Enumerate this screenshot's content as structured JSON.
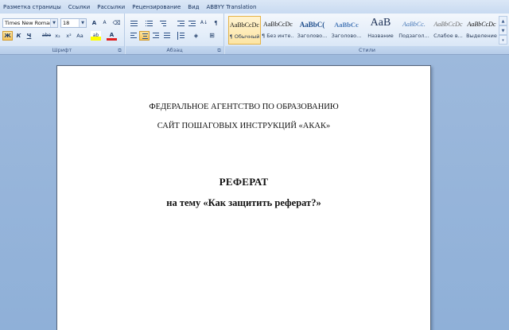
{
  "tabs": [
    "Разметка страницы",
    "Ссылки",
    "Рассылки",
    "Рецензирование",
    "Вид",
    "ABBYY Translation"
  ],
  "font": {
    "name": "Times New Roman",
    "size": "18",
    "group_label": "Шрифт",
    "buttons": {
      "grow": "A",
      "shrink": "A",
      "clear": "⌫",
      "bold": "Ж",
      "italic": "К",
      "underline": "Ч",
      "strike": "abe",
      "subscript": "x₂",
      "superscript": "x²",
      "change_case": "Aa",
      "highlight": "ab",
      "font_color": "A"
    }
  },
  "paragraph": {
    "group_label": "Абзац",
    "buttons": {
      "show_marks": "¶",
      "sort": "A↓"
    }
  },
  "styles": {
    "group_label": "Стили",
    "items": [
      {
        "sample": "AaBbCcDc",
        "name": "¶ Обычный"
      },
      {
        "sample": "AaBbCcDc",
        "name": "¶ Без инте..."
      },
      {
        "sample": "AaBbC(",
        "name": "Заголово..."
      },
      {
        "sample": "AaBbCc",
        "name": "Заголово..."
      },
      {
        "sample": "AaB",
        "name": "Название"
      },
      {
        "sample": "AaBbCc.",
        "name": "Подзагол..."
      },
      {
        "sample": "AaBbCcDc",
        "name": "Слабое в..."
      },
      {
        "sample": "AaBbCcDc",
        "name": "Выделение"
      }
    ]
  },
  "document": {
    "lines": [
      "ФЕДЕРАЛЬНОЕ АГЕНТСТВО ПО ОБРАЗОВАНИЮ",
      "САЙТ ПОШАГОВЫХ ИНСТРУКЦИЙ «АКАК»",
      "РЕФЕРАТ",
      "на тему «Как защитить реферат?»"
    ]
  },
  "colors": {
    "highlight": "#ffff00",
    "font_color": "#e02020",
    "accent": "#2b579a"
  }
}
